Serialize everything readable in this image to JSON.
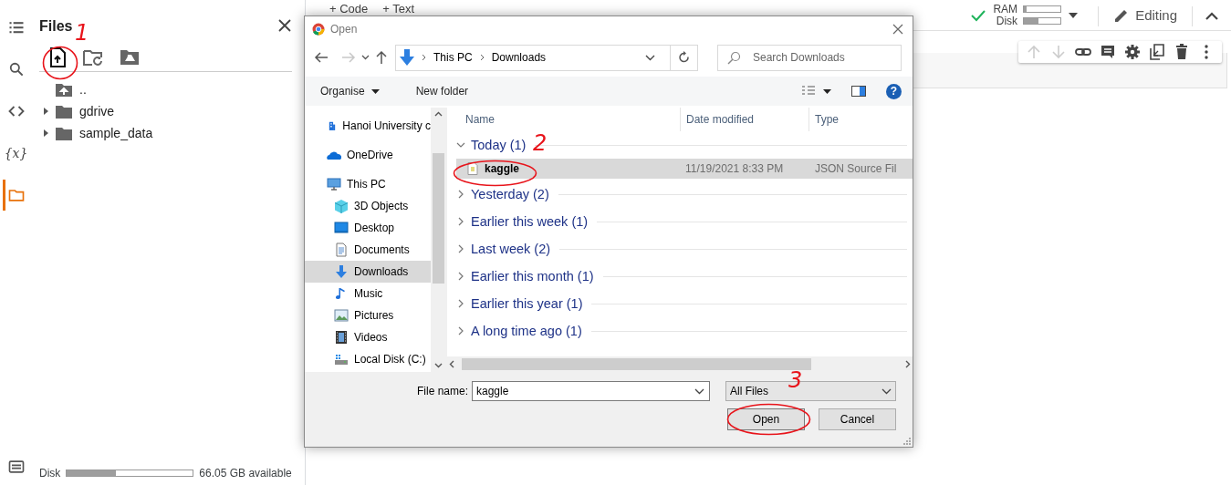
{
  "rail": [
    {
      "selected": false
    },
    {
      "selected": false
    },
    {
      "selected": false
    },
    {
      "glyph": "{x}",
      "selected": false
    },
    {
      "selected": true
    },
    {
      "selected": false
    }
  ],
  "files_panel": {
    "title": "Files",
    "tree": [
      {
        "kind": "parent",
        "label": ".."
      },
      {
        "kind": "folder",
        "label": "gdrive",
        "expanded": false
      },
      {
        "kind": "folder",
        "label": "sample_data",
        "expanded": false
      }
    ],
    "disk": {
      "label": "Disk",
      "level": 0.39,
      "reading": "66.05 GB available"
    }
  },
  "top_bar": {
    "buttons": [
      "+ Code",
      "+ Text"
    ],
    "resources": [
      {
        "label": "RAM",
        "level": 0.08
      },
      {
        "label": "Disk",
        "level": 0.4
      }
    ],
    "mode": "Editing"
  },
  "cell_toolbar": [
    {
      "disabled": true
    },
    {
      "disabled": true
    },
    {
      "disabled": false
    },
    {
      "disabled": false
    },
    {
      "disabled": false
    },
    {
      "disabled": false
    },
    {
      "disabled": false
    },
    {
      "disabled": false
    }
  ],
  "dialog": {
    "title": "Open",
    "nav_buttons": [
      {
        "disabled": false
      },
      {
        "disabled": true
      },
      {
        "disabled": false
      },
      {
        "disabled": false
      }
    ],
    "address": [
      "This PC",
      "Downloads"
    ],
    "search": {
      "placeholder": "Search Downloads"
    },
    "commands": [
      "Organise",
      "New folder"
    ],
    "help": "?",
    "nav_pane": [
      {
        "label": "Hanoi University c",
        "selected": false
      },
      {
        "label": "OneDrive",
        "selected": false
      },
      {
        "label": "This PC",
        "selected": false
      },
      {
        "label": "3D Objects",
        "selected": false
      },
      {
        "label": "Desktop",
        "selected": false
      },
      {
        "label": "Documents",
        "selected": false
      },
      {
        "label": "Downloads",
        "selected": true
      },
      {
        "label": "Music",
        "selected": false
      },
      {
        "label": "Pictures",
        "selected": false
      },
      {
        "label": "Videos",
        "selected": false
      },
      {
        "label": "Local Disk (C:)",
        "selected": false
      }
    ],
    "columns": [
      "Name",
      "Date modified",
      "Type"
    ],
    "groups": [
      {
        "label": "Today (1)",
        "expanded": true,
        "files": [
          {
            "name": "kaggle",
            "date": "11/19/2021 8:33 PM",
            "type": "JSON Source Fil",
            "selected": true
          }
        ]
      },
      {
        "label": "Yesterday (2)",
        "expanded": false
      },
      {
        "label": "Earlier this week (1)",
        "expanded": false
      },
      {
        "label": "Last week (2)",
        "expanded": false
      },
      {
        "label": "Earlier this month (1)",
        "expanded": false
      },
      {
        "label": "Earlier this year (1)",
        "expanded": false
      },
      {
        "label": "A long time ago (1)",
        "expanded": false
      }
    ],
    "file_name": {
      "label": "File name:",
      "value": "kaggle"
    },
    "file_type": "All Files",
    "buttons": [
      "Open",
      "Cancel"
    ]
  },
  "annotations": [
    {
      "label": "1"
    },
    {
      "label": "2"
    },
    {
      "label": "3"
    }
  ]
}
